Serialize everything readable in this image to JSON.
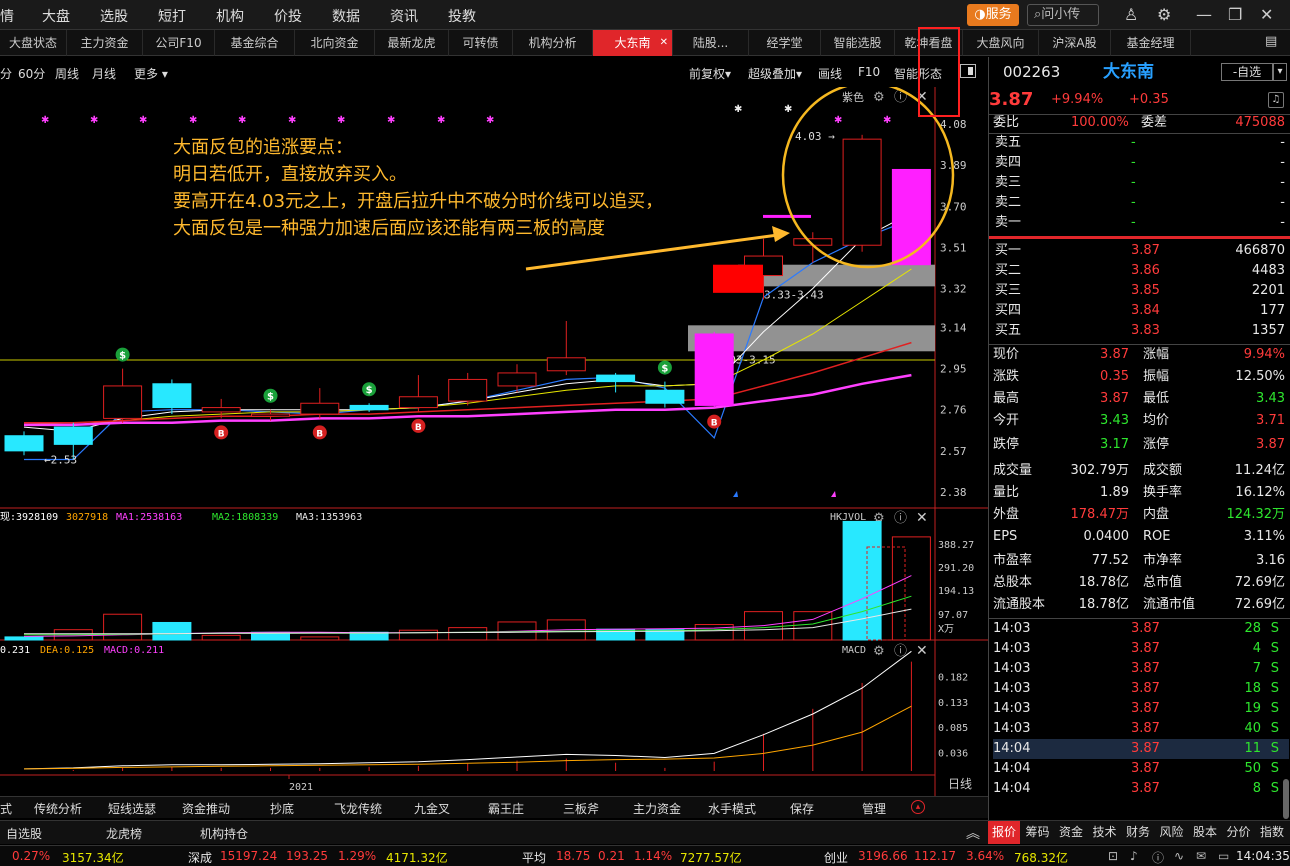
{
  "topbar": {
    "menus": [
      "情",
      "大盘",
      "选股",
      "短打",
      "机构",
      "价投",
      "数据",
      "资讯",
      "投教"
    ],
    "service_label": "服务",
    "search_label": "问小传"
  },
  "tabs": [
    "大盘状态",
    "主力资金",
    "公司F10",
    "基金综合",
    "北向资金",
    "最新龙虎",
    "可转债",
    "机构分析",
    "大东南",
    "陆股...",
    "经学堂",
    "智能选股",
    "乾坤看盘",
    "大盘风向",
    "沪深A股",
    "基金经理"
  ],
  "chart_toolbar": {
    "left": [
      "分",
      "60分",
      "周线",
      "月线",
      "更多 ▾"
    ],
    "right": [
      "前复权▾",
      "超级叠加▾",
      "画线",
      "F10",
      "智能形态"
    ]
  },
  "price_panel": {
    "overlay_label": "紫色",
    "y_ticks": [
      "4.08",
      "3.89",
      "3.70",
      "3.51",
      "3.32",
      "3.14",
      "2.95",
      "2.76",
      "2.57",
      "2.38"
    ],
    "marker_high": "4.03",
    "marker_low": "←2.53",
    "zone1": "3.33-3.43",
    "zone2": "3.03-3.15",
    "annotation": [
      "大面反包的追涨要点：",
      "明日若低开，直接放弃买入。",
      "要高开在4.03元之上，开盘后拉升中不破分时价线可以追买，",
      "大面反包是一种强力加速后面应该还能有两三板的高度"
    ]
  },
  "vol_panel": {
    "legend": [
      {
        "text": "现:3928109",
        "color": "#ffffff"
      },
      {
        "text": "3027918",
        "color": "#ffa500"
      },
      {
        "text": "MA1:2538163",
        "color": "#ff40ff"
      },
      {
        "text": "MA2:1808339",
        "color": "#2ee62e"
      },
      {
        "text": "MA3:1353963",
        "color": "#e8e8e8"
      }
    ],
    "label": "HKJVOL",
    "y_ticks": [
      "388.27",
      "291.20",
      "194.13",
      "97.07",
      "X万"
    ]
  },
  "macd_panel": {
    "legend": [
      {
        "text": "0.231",
        "color": "#ffffff"
      },
      {
        "text": "DEA:0.125",
        "color": "#ffa500"
      },
      {
        "text": "MACD:0.211",
        "color": "#ff40ff"
      }
    ],
    "label": "MACD",
    "y_ticks": [
      "0.182",
      "0.133",
      "0.085",
      "0.036"
    ],
    "year_label": "2021",
    "period_label": "日线"
  },
  "quote": {
    "code": "002263",
    "name": "大东南",
    "watch_label": "-自选",
    "price": "3.87",
    "pct": "+9.94%",
    "chg": "+0.35",
    "webi_label": "委比",
    "webi": "100.00%",
    "weicha_label": "委差",
    "weicha": "475088",
    "sells": [
      {
        "label": "卖五",
        "price": "-",
        "vol": "-"
      },
      {
        "label": "卖四",
        "price": "-",
        "vol": "-"
      },
      {
        "label": "卖三",
        "price": "-",
        "vol": "-"
      },
      {
        "label": "卖二",
        "price": "-",
        "vol": "-"
      },
      {
        "label": "卖一",
        "price": "-",
        "vol": "-"
      }
    ],
    "buys": [
      {
        "label": "买一",
        "price": "3.87",
        "vol": "466870"
      },
      {
        "label": "买二",
        "price": "3.86",
        "vol": "4483"
      },
      {
        "label": "买三",
        "price": "3.85",
        "vol": "2201"
      },
      {
        "label": "买四",
        "price": "3.84",
        "vol": "177"
      },
      {
        "label": "买五",
        "price": "3.83",
        "vol": "1357"
      }
    ],
    "stats": [
      [
        {
          "l": "现价",
          "v": "3.87",
          "c": "red"
        },
        {
          "l": "涨幅",
          "v": "9.94%",
          "c": "red"
        }
      ],
      [
        {
          "l": "涨跌",
          "v": "0.35",
          "c": "red"
        },
        {
          "l": "振幅",
          "v": "12.50%",
          "c": "white"
        }
      ],
      [
        {
          "l": "最高",
          "v": "3.87",
          "c": "red"
        },
        {
          "l": "最低",
          "v": "3.43",
          "c": "green"
        }
      ],
      [
        {
          "l": "今开",
          "v": "3.43",
          "c": "green"
        },
        {
          "l": "均价",
          "v": "3.71",
          "c": "red"
        }
      ],
      [
        {
          "l": "跌停",
          "v": "3.17",
          "c": "green"
        },
        {
          "l": "涨停",
          "v": "3.87",
          "c": "red"
        }
      ],
      [
        {
          "l": "成交量",
          "v": "302.79万",
          "c": "white"
        },
        {
          "l": "成交额",
          "v": "11.24亿",
          "c": "white"
        }
      ],
      [
        {
          "l": "量比",
          "v": "1.89",
          "c": "white"
        },
        {
          "l": "换手率",
          "v": "16.12%",
          "c": "white"
        }
      ],
      [
        {
          "l": "外盘",
          "v": "178.47万",
          "c": "red"
        },
        {
          "l": "内盘",
          "v": "124.32万",
          "c": "green"
        }
      ],
      [
        {
          "l": "EPS",
          "v": "0.0400",
          "c": "white"
        },
        {
          "l": "ROE",
          "v": "3.11%",
          "c": "white"
        }
      ],
      [
        {
          "l": "市盈率",
          "v": "77.52",
          "c": "white"
        },
        {
          "l": "市净率",
          "v": "3.16",
          "c": "white"
        }
      ],
      [
        {
          "l": "总股本",
          "v": "18.78亿",
          "c": "white"
        },
        {
          "l": "总市值",
          "v": "72.69亿",
          "c": "white"
        }
      ],
      [
        {
          "l": "流通股本",
          "v": "18.78亿",
          "c": "white"
        },
        {
          "l": "流通市值",
          "v": "72.69亿",
          "c": "white"
        }
      ]
    ],
    "ticks": [
      {
        "t": "14:03",
        "p": "3.87",
        "v": "28",
        "s": "S"
      },
      {
        "t": "14:03",
        "p": "3.87",
        "v": "4",
        "s": "S"
      },
      {
        "t": "14:03",
        "p": "3.87",
        "v": "7",
        "s": "S"
      },
      {
        "t": "14:03",
        "p": "3.87",
        "v": "18",
        "s": "S"
      },
      {
        "t": "14:03",
        "p": "3.87",
        "v": "19",
        "s": "S"
      },
      {
        "t": "14:03",
        "p": "3.87",
        "v": "40",
        "s": "S"
      },
      {
        "t": "14:04",
        "p": "3.87",
        "v": "11",
        "s": "S"
      },
      {
        "t": "14:04",
        "p": "3.87",
        "v": "50",
        "s": "S"
      },
      {
        "t": "14:04",
        "p": "3.87",
        "v": "8",
        "s": "S"
      }
    ],
    "right_tabs": [
      "报价",
      "筹码",
      "资金",
      "技术",
      "财务",
      "风险",
      "股本",
      "分价",
      "指数"
    ]
  },
  "bottom_tabs": [
    "式",
    "传统分析",
    "短线选瑟",
    "资金推动",
    "抄底",
    "飞龙传统",
    "九金叉",
    "霸王庄",
    "三板斧",
    "主力资金",
    "水手模式",
    "保存",
    "管理"
  ],
  "bottom_tabs2": [
    "自选股",
    "龙虎榜",
    "机构持仓"
  ],
  "status": {
    "sh_pct": "0.27%",
    "sh_amt": "3157.34亿",
    "sz_label": "深成",
    "sz_val": "15197.24",
    "sz_chg": "193.25",
    "sz_pct": "1.29%",
    "sz_amt": "4171.32亿",
    "avg_label": "平均",
    "avg_val": "18.75",
    "avg_chg": "0.21",
    "avg_pct": "1.14%",
    "avg_amt": "7277.57亿",
    "cy_label": "创业",
    "cy_val": "3196.66",
    "cy_chg": "112.17",
    "cy_pct": "3.64%",
    "cy_amt": "768.32亿",
    "time": "14:04:35"
  },
  "chart_data": [
    {
      "type": "candlestick",
      "title": "",
      "ylim": [
        2.38,
        4.08
      ],
      "candles": [
        {
          "o": 2.64,
          "c": 2.57,
          "h": 2.66,
          "l": 2.55
        },
        {
          "o": 2.68,
          "c": 2.6,
          "h": 2.7,
          "l": 2.53
        },
        {
          "o": 2.72,
          "c": 2.87,
          "h": 2.95,
          "l": 2.7
        },
        {
          "o": 2.88,
          "c": 2.77,
          "h": 2.9,
          "l": 2.74
        },
        {
          "o": 2.75,
          "c": 2.77,
          "h": 2.81,
          "l": 2.72
        },
        {
          "o": 2.73,
          "c": 2.74,
          "h": 2.76,
          "l": 2.71
        },
        {
          "o": 2.74,
          "c": 2.79,
          "h": 2.86,
          "l": 2.72
        },
        {
          "o": 2.78,
          "c": 2.76,
          "h": 2.79,
          "l": 2.75
        },
        {
          "o": 2.77,
          "c": 2.82,
          "h": 2.92,
          "l": 2.75
        },
        {
          "o": 2.8,
          "c": 2.9,
          "h": 2.93,
          "l": 2.78
        },
        {
          "o": 2.87,
          "c": 2.93,
          "h": 2.97,
          "l": 2.84
        },
        {
          "o": 2.94,
          "c": 3.0,
          "h": 3.17,
          "l": 2.92
        },
        {
          "o": 2.92,
          "c": 2.89,
          "h": 2.93,
          "l": 2.84
        },
        {
          "o": 2.85,
          "c": 2.79,
          "h": 2.89,
          "l": 2.77
        },
        {
          "o": 2.78,
          "c": 3.11,
          "h": 3.12,
          "l": 2.77
        },
        {
          "o": 3.38,
          "c": 3.47,
          "h": 3.55,
          "l": 3.27
        },
        {
          "o": 3.52,
          "c": 3.55,
          "h": 3.58,
          "l": 3.44
        },
        {
          "o": 3.52,
          "c": 4.01,
          "h": 4.03,
          "l": 3.49
        },
        {
          "o": 3.43,
          "c": 3.87,
          "h": 3.87,
          "l": 3.43
        }
      ],
      "overlay_lines": [
        {
          "name": "",
          "values": [
            2.53,
            2.53,
            2.75,
            2.76,
            2.76,
            2.75,
            2.74,
            2.76,
            2.77,
            2.8,
            2.85,
            2.9,
            2.91,
            2.86,
            2.63,
            3.28,
            3.44,
            3.55,
            3.64
          ]
        },
        {
          "name": "",
          "values": [
            2.68,
            2.66,
            2.72,
            2.75,
            2.76,
            2.76,
            2.76,
            2.76,
            2.77,
            2.8,
            2.84,
            2.88,
            2.9,
            2.87,
            2.88,
            3.12,
            3.32,
            3.55,
            3.67
          ]
        },
        {
          "name": "",
          "values": [
            2.7,
            2.69,
            2.71,
            2.73,
            2.74,
            2.75,
            2.75,
            2.76,
            2.77,
            2.79,
            2.82,
            2.85,
            2.87,
            2.87,
            2.88,
            2.99,
            3.11,
            3.26,
            3.41
          ]
        },
        {
          "name": "",
          "values": [
            2.7,
            2.7,
            2.71,
            2.72,
            2.73,
            2.73,
            2.74,
            2.74,
            2.75,
            2.76,
            2.77,
            2.78,
            2.79,
            2.8,
            2.81,
            2.87,
            2.93,
            3.0,
            3.07
          ]
        },
        {
          "name": "",
          "values": [
            2.69,
            2.69,
            2.7,
            2.7,
            2.71,
            2.71,
            2.72,
            2.72,
            2.73,
            2.73,
            2.74,
            2.75,
            2.76,
            2.76,
            2.77,
            2.8,
            2.83,
            2.88,
            2.92
          ]
        }
      ],
      "reference_line": 2.99,
      "zones": [
        {
          "lo": 3.33,
          "hi": 3.43,
          "label": "3.33-3.43"
        },
        {
          "lo": 3.03,
          "hi": 3.15,
          "label": "3.03-3.15"
        }
      ],
      "signals": [
        {
          "index": 2,
          "type": "S"
        },
        {
          "index": 4,
          "type": "B"
        },
        {
          "index": 5,
          "type": "S"
        },
        {
          "index": 6,
          "type": "B"
        },
        {
          "index": 7,
          "type": "S"
        },
        {
          "index": 8,
          "type": "B"
        },
        {
          "index": 13,
          "type": "S"
        },
        {
          "index": 14,
          "type": "B"
        }
      ]
    },
    {
      "type": "bar",
      "title": "HKJVOL",
      "ylim": [
        0,
        450
      ],
      "values": [
        12,
        40,
        100,
        68,
        18,
        30,
        12,
        30,
        38,
        48,
        70,
        78,
        42,
        40,
        60,
        110,
        110,
        460,
        400
      ],
      "up": [
        false,
        true,
        true,
        false,
        true,
        false,
        true,
        false,
        true,
        true,
        true,
        true,
        false,
        false,
        true,
        true,
        true,
        false,
        true
      ]
    },
    {
      "type": "line",
      "title": "MACD",
      "ylim": [
        0,
        0.22
      ],
      "dif": [
        0.004,
        0.006,
        0.01,
        0.012,
        0.012,
        0.013,
        0.014,
        0.016,
        0.018,
        0.022,
        0.027,
        0.032,
        0.03,
        0.026,
        0.034,
        0.07,
        0.11,
        0.16,
        0.231
      ],
      "dea": [
        0.004,
        0.005,
        0.007,
        0.008,
        0.009,
        0.01,
        0.011,
        0.012,
        0.013,
        0.015,
        0.017,
        0.02,
        0.022,
        0.023,
        0.025,
        0.034,
        0.05,
        0.075,
        0.125
      ],
      "macd": [
        0.0,
        0.002,
        0.006,
        0.008,
        0.006,
        0.006,
        0.006,
        0.008,
        0.01,
        0.014,
        0.02,
        0.024,
        0.016,
        0.006,
        0.018,
        0.072,
        0.12,
        0.17,
        0.211
      ]
    }
  ]
}
